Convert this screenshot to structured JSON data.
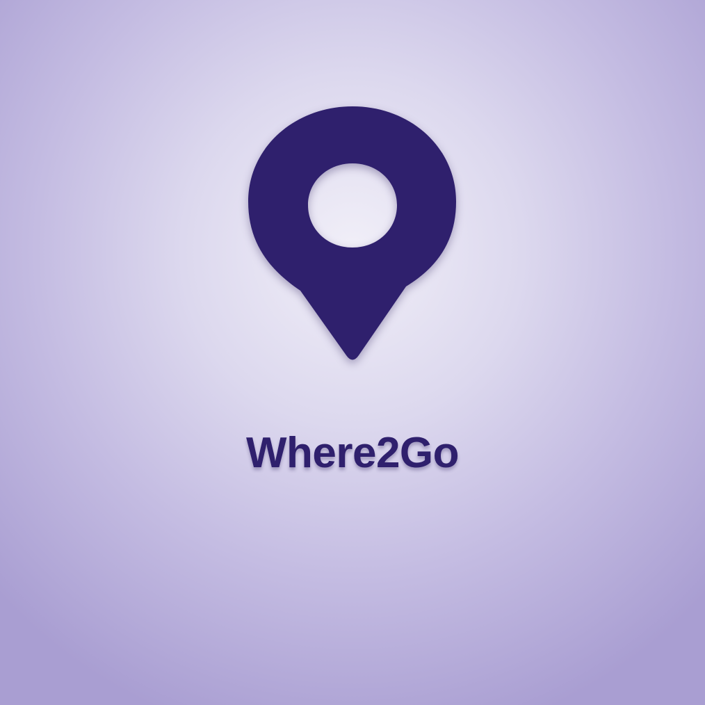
{
  "app": {
    "name": "Where2Go",
    "logo_icon": "map-pin-icon"
  },
  "colors": {
    "brand": "#2f206d",
    "background_center": "#f1eff8",
    "background_edge": "#a99ed2"
  }
}
